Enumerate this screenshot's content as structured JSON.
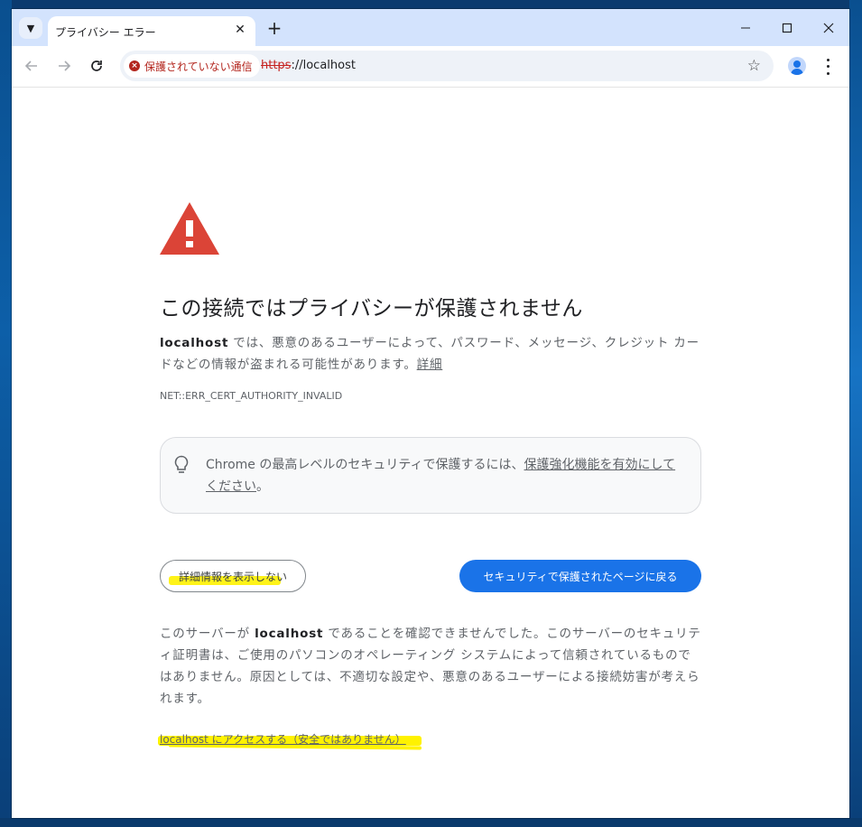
{
  "browser": {
    "tab_title": "プライバシー エラー",
    "security_chip": "保護されていない通信",
    "url_scheme": "https",
    "url_rest": "://localhost"
  },
  "page": {
    "heading": "この接続ではプライバシーが保護されません",
    "host": "localhost",
    "desc_text": " では、悪意のあるユーザーによって、パスワード、メッセージ、クレジット カードなどの情報が盗まれる可能性があります。",
    "desc_link": "詳細",
    "error_code": "NET::ERR_CERT_AUTHORITY_INVALID",
    "tip_text": "Chrome の最高レベルのセキュリティで保護するには、",
    "tip_link": "保護強化機能を有効にしてください",
    "tip_end": "。",
    "details_button": "詳細情報を表示しない",
    "back_button": "セキュリティで保護されたページに戻る",
    "details_prefix": "このサーバーが ",
    "details_suffix": " であることを確認できませんでした。このサーバーのセキュリティ証明書は、ご使用のパソコンのオペレーティング システムによって信頼されているものではありません。原因としては、不適切な設定や、悪意のあるユーザーによる接続妨害が考えられます。",
    "proceed_link": "localhost にアクセスする（安全ではありません）"
  },
  "colors": {
    "warning_red": "#db4437",
    "primary_blue": "#1a73e8",
    "highlight_yellow": "#fff200"
  }
}
